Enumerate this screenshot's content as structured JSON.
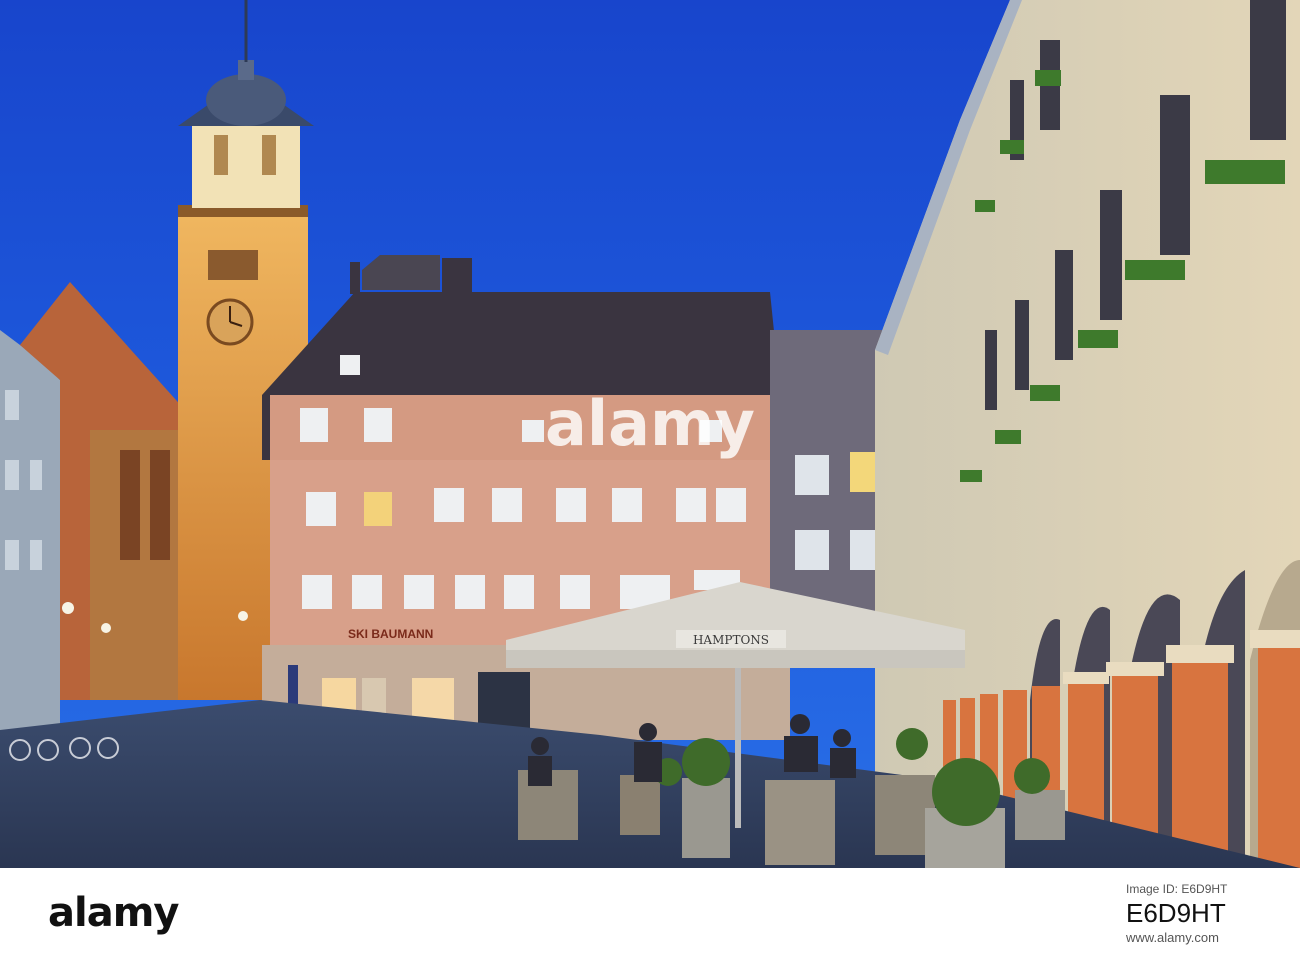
{
  "photo": {
    "watermark": "alamy",
    "umbrella_sign": "HAMPTONS",
    "shop_sign": "SKI BAUMANN"
  },
  "footer": {
    "logo": "alamy",
    "image_id_label": "Image ID: E6D9HT",
    "image_id": "E6D9HT",
    "url": "www.alamy.com"
  },
  "colors": {
    "sky": "#1d52d9",
    "tower_glow": "#e39a3a",
    "arcade_columns": "#d8743f"
  }
}
